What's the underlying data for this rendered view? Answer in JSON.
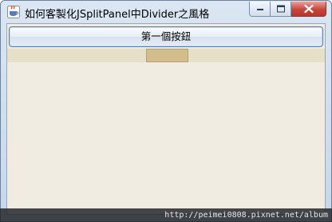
{
  "window": {
    "title": "如何客製化JSplitPanel中Divider之風格",
    "app_icon": "java-cup-icon",
    "controls": {
      "minimize_icon": "minimize-icon",
      "maximize_icon": "maximize-icon",
      "close_icon": "close-icon"
    }
  },
  "content": {
    "top_button_label": "第一個按鈕",
    "divider_color": "#e8dfc9",
    "divider_handle_color": "#d4bd8c",
    "background_color": "#f0ece1"
  },
  "watermark": {
    "text": "http://peimei0808.pixnet.net/album"
  }
}
